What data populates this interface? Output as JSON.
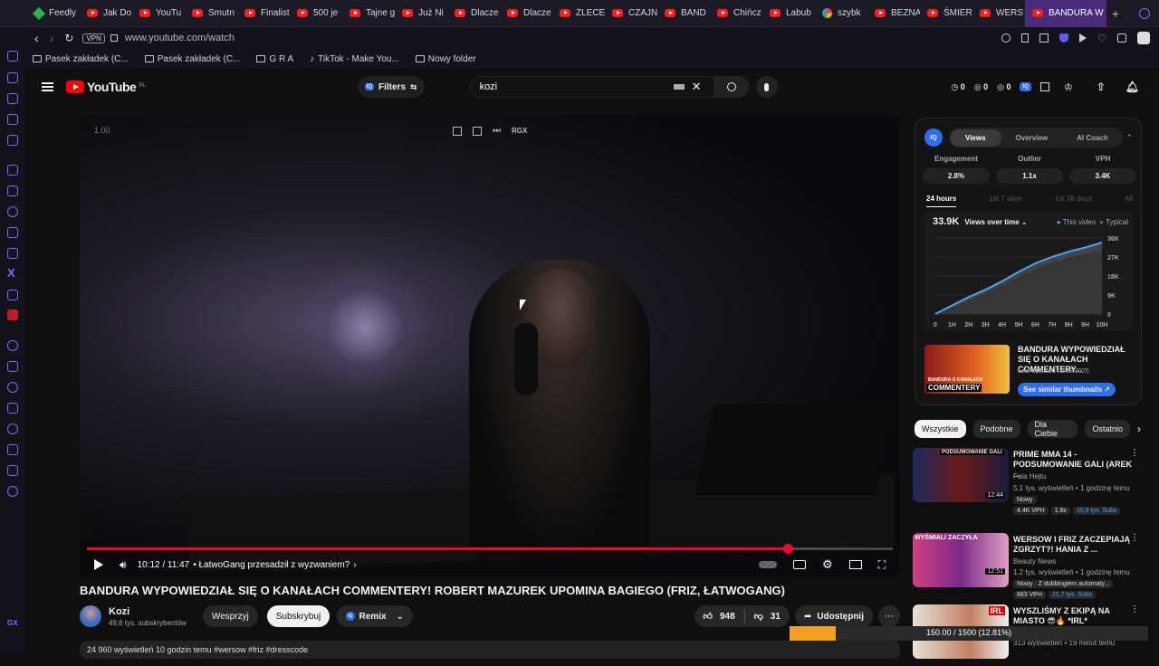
{
  "browser": {
    "tabs": [
      {
        "label": "Feedly",
        "icon": "feedly-icon"
      },
      {
        "label": "Jak Do",
        "icon": "youtube-icon"
      },
      {
        "label": "YouTu",
        "icon": "youtube-icon"
      },
      {
        "label": "Smutn",
        "icon": "youtube-icon"
      },
      {
        "label": "Finalist",
        "icon": "youtube-icon"
      },
      {
        "label": "500 je",
        "icon": "youtube-icon"
      },
      {
        "label": "Tajne g",
        "icon": "youtube-icon"
      },
      {
        "label": "Już Ni",
        "icon": "youtube-icon"
      },
      {
        "label": "Dlacze",
        "icon": "youtube-icon"
      },
      {
        "label": "Dlacze",
        "icon": "youtube-icon"
      },
      {
        "label": "ZLECE",
        "icon": "youtube-icon"
      },
      {
        "label": "CZAJN",
        "icon": "youtube-icon"
      },
      {
        "label": "BAND",
        "icon": "youtube-icon"
      },
      {
        "label": "Chińcz",
        "icon": "youtube-icon"
      },
      {
        "label": "Labub",
        "icon": "youtube-icon"
      },
      {
        "label": "szybk",
        "icon": "google-icon"
      },
      {
        "label": "BEZNA",
        "icon": "youtube-icon"
      },
      {
        "label": "ŚMIER",
        "icon": "youtube-icon"
      },
      {
        "label": "WERS",
        "icon": "youtube-icon"
      }
    ],
    "active_tab": "BANDURA W",
    "vpn_badge": "VPN",
    "url": "www.youtube.com/watch",
    "bookmarks": [
      "Pasek zakładek (C...",
      "Pasek zakładek (C...",
      "G R A",
      "TikTok - Make You...",
      "Nowy folder"
    ]
  },
  "youtube": {
    "logo_text": "YouTube",
    "logo_sup": "PL",
    "filters_label": "Filters",
    "search_value": "kozi",
    "badge_iq": "IQ",
    "counters": [
      "0",
      "0",
      "0"
    ]
  },
  "player": {
    "speed_overlay": "1.00",
    "overlay_rgx": "RGX",
    "time": "10:12 / 11:47",
    "chapter": "• ŁatwoGang przesadził z wyzwaniem?",
    "progress": 0.87
  },
  "video": {
    "title": "BANDURA WYPOWIEDZIAŁ SIĘ O KANAŁACH COMMENTERY! ROBERT MAZUREK UPOMINA BAGIEGO (FRIZ, ŁATWOGANG)",
    "channel": "Kozi",
    "subs": "49,6 tys. subskrybentów",
    "support": "Wesprzyj",
    "subscribe": "Subskrybuj",
    "remix": "Remix",
    "likes": "948",
    "dislikes": "31",
    "share": "Udostępnij",
    "bottom_partial": "24 960 wyświetleń  10 godzin temu  #wersow #friz #dresscode"
  },
  "vidiq": {
    "badge": "IQ",
    "tabs": [
      "Views",
      "Overview",
      "AI Coach"
    ],
    "metrics": [
      {
        "label": "Engagement",
        "value": "2.8%"
      },
      {
        "label": "Outlier",
        "value": "1.1x"
      },
      {
        "label": "VPH",
        "value": "3.4K"
      }
    ],
    "ranges": [
      "24 hours",
      "1st 7 days",
      "1st 28 days",
      "All"
    ],
    "views_total": "33.9K",
    "views_label": "Views over time",
    "legend_this": "This video",
    "legend_typical": "Typical",
    "thumb_title": "BANDURA WYPOWIEDZIAŁ SIĘ O KANAŁACH COMMENTERY...",
    "thumb_updated": "Last Updated 10/13/2025",
    "thumb_button": "See similar thumbnails ↗",
    "thumb_caption": "COMMENTERY",
    "thumb_small": "BANDURA O KANAŁACH"
  },
  "chart_data": {
    "type": "area",
    "x": [
      "0",
      "1H",
      "2H",
      "3H",
      "4H",
      "5H",
      "6H",
      "7H",
      "8H",
      "9H",
      "10H"
    ],
    "y_ticks": [
      "36K",
      "27K",
      "18K",
      "9K",
      "0"
    ],
    "ylim": [
      0,
      36000
    ],
    "series": [
      {
        "name": "This video",
        "values": [
          0,
          4000,
          8000,
          11500,
          15500,
          20000,
          24000,
          27000,
          29500,
          31500,
          33900
        ]
      },
      {
        "name": "Typical",
        "values": [
          0,
          3000,
          6500,
          10000,
          13500,
          17500,
          21000,
          24000,
          26500,
          28500,
          30000
        ]
      }
    ]
  },
  "recommendations": {
    "chips": [
      "Wszystkie",
      "Podobne",
      "Dla Ciebie",
      "Ostatnio"
    ],
    "items": [
      {
        "title": "PRIME MMA 14 - PODSUMOWANIE GALI (AREK ...",
        "channel": "Fala Hejtu",
        "meta": "5,1 tys. wyświetleń • 1 godzinę temu",
        "badge": "Nowy",
        "duration": "12:44",
        "thumb_text": "PODSUMOWANIE GALI",
        "tags": [
          "4.4K VPH",
          "1.8x",
          "20,8 tys. Subs"
        ]
      },
      {
        "title": "WERSOW I FRIZ ZACZEPIAJĄ ZGRZYT?! HANIA Z ...",
        "channel": "Beauty News",
        "meta": "1,2 tys. wyświetleń • 1 godzinę temu",
        "badge": "Nowy · Z dubbingiem automaty...",
        "duration": "12:51",
        "thumb_text": "WYŚMIALI ZACZYŁA",
        "tags": [
          "883 VPH",
          "21,7 tys. Subs"
        ]
      },
      {
        "title": "WYSZLIŚMY Z EKIPĄ NA MIASTO 😎🔥 *IRL*",
        "channel": "",
        "meta": "313 wyświetleń • 19 minut temu",
        "badge": "",
        "duration": "",
        "thumb_text": "IRL",
        "tags": []
      }
    ]
  },
  "download": {
    "text": "150.00 / 1500 (12.81%)",
    "progress": 0.128
  }
}
